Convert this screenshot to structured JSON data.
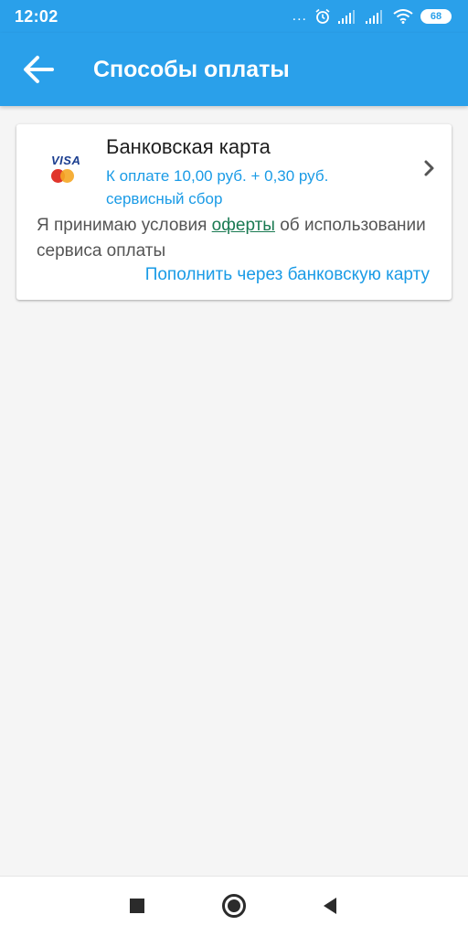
{
  "status_bar": {
    "time": "12:02",
    "dots": "...",
    "battery": "68"
  },
  "app_bar": {
    "title": "Способы оплаты",
    "back_icon": "arrow-left-icon"
  },
  "payment_method": {
    "title": "Банковская карта",
    "price": "К оплате 10,00 руб. + 0,30 руб. сервисный сбор",
    "icon_text": "VISA",
    "terms_before": "Я принимаю условия ",
    "terms_link": "оферты",
    "terms_after": " об использовании сервиса оплаты",
    "topup_label": "Пополнить через банковскую карту"
  },
  "nav_bar": {
    "recent_icon": "square-icon",
    "home_icon": "circle-icon",
    "back_icon": "triangle-back-icon"
  },
  "colors": {
    "primary": "#2aa0ea",
    "link_blue": "#1a9be6",
    "offer_green": "#1a7a52",
    "background": "#f5f5f5"
  }
}
